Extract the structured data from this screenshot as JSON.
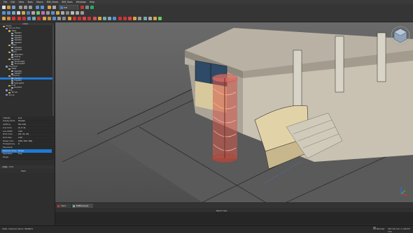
{
  "menu": [
    "File",
    "Edit",
    "View",
    "Tools",
    "Macro",
    "BIM_Views",
    "BIM_Tools",
    "Windows",
    "Help"
  ],
  "toolbar": {
    "workbench_label": "BIM Workbench"
  },
  "tree": {
    "header": "Labels",
    "rows": [
      {
        "label": "Model",
        "indent": 0
      },
      {
        "label": "Ground Floor",
        "indent": 1
      },
      {
        "label": "Walls",
        "indent": 2
      },
      {
        "label": "Wall001",
        "indent": 3
      },
      {
        "label": "Wall002",
        "indent": 3
      },
      {
        "label": "Wall003",
        "indent": 3
      },
      {
        "label": "Wall004",
        "indent": 3
      },
      {
        "label": "Wall005",
        "indent": 3
      },
      {
        "label": "Slabs",
        "indent": 2
      },
      {
        "label": "Slab001",
        "indent": 3
      },
      {
        "label": "Slab002",
        "indent": 3
      },
      {
        "label": "Stairs",
        "indent": 2
      },
      {
        "label": "Stairs001",
        "indent": 3
      },
      {
        "label": "Railing",
        "indent": 3
      },
      {
        "label": "Windows",
        "indent": 2
      },
      {
        "label": "Window001",
        "indent": 3
      },
      {
        "label": "Window002",
        "indent": 3
      },
      {
        "label": "First Floor",
        "indent": 1
      },
      {
        "label": "Walls",
        "indent": 2
      },
      {
        "label": "Wall006",
        "indent": 3
      },
      {
        "label": "Wall007",
        "indent": 3
      },
      {
        "label": "Columns",
        "indent": 2
      },
      {
        "label": "Pipe001",
        "indent": 3
      },
      {
        "label": "Pipe002",
        "indent": 3
      },
      {
        "label": "Railing001",
        "indent": 3
      },
      {
        "label": "Roof",
        "indent": 2
      },
      {
        "label": "Roof001",
        "indent": 3
      },
      {
        "label": "Site",
        "indent": 1
      },
      {
        "label": "Terrain",
        "indent": 2
      },
      {
        "label": "Group",
        "indent": 1
      }
    ],
    "selected_index": 22
  },
  "properties": {
    "rows": [
      {
        "k": "Visibility",
        "v": "true"
      },
      {
        "k": "Display Mode",
        "v": "Shaded"
      },
      {
        "k": "Lighting",
        "v": "Two side"
      },
      {
        "k": "Line Color",
        "v": "[0, 0, 0]"
      },
      {
        "k": "Line Width",
        "v": "2.00"
      },
      {
        "k": "Point Color",
        "v": "[25, 25, 25]"
      },
      {
        "k": "Point Size",
        "v": "2.00"
      },
      {
        "k": "Shape Color",
        "v": "[200, 200, 200]"
      },
      {
        "k": "Transparency",
        "v": "0"
      },
      {
        "k": "Placement",
        "v": ""
      },
      {
        "k": "Selection Style",
        "v": "Shape"
      },
      {
        "k": "Selectable",
        "v": "true"
      },
      {
        "k": "Shape",
        "v": ""
      }
    ],
    "tabs": [
      "View",
      "Data"
    ]
  },
  "report_label": "Report view",
  "doc_tabs": [
    "Start",
    "BIMExample"
  ],
  "status": {
    "left": "Valid, Internal name: Wall001",
    "right": "287.25 mm x 140.83 mm",
    "nav": "Blender"
  },
  "colors": {
    "accent": "#1e7ad6",
    "viewport": "#5e5e5e"
  }
}
